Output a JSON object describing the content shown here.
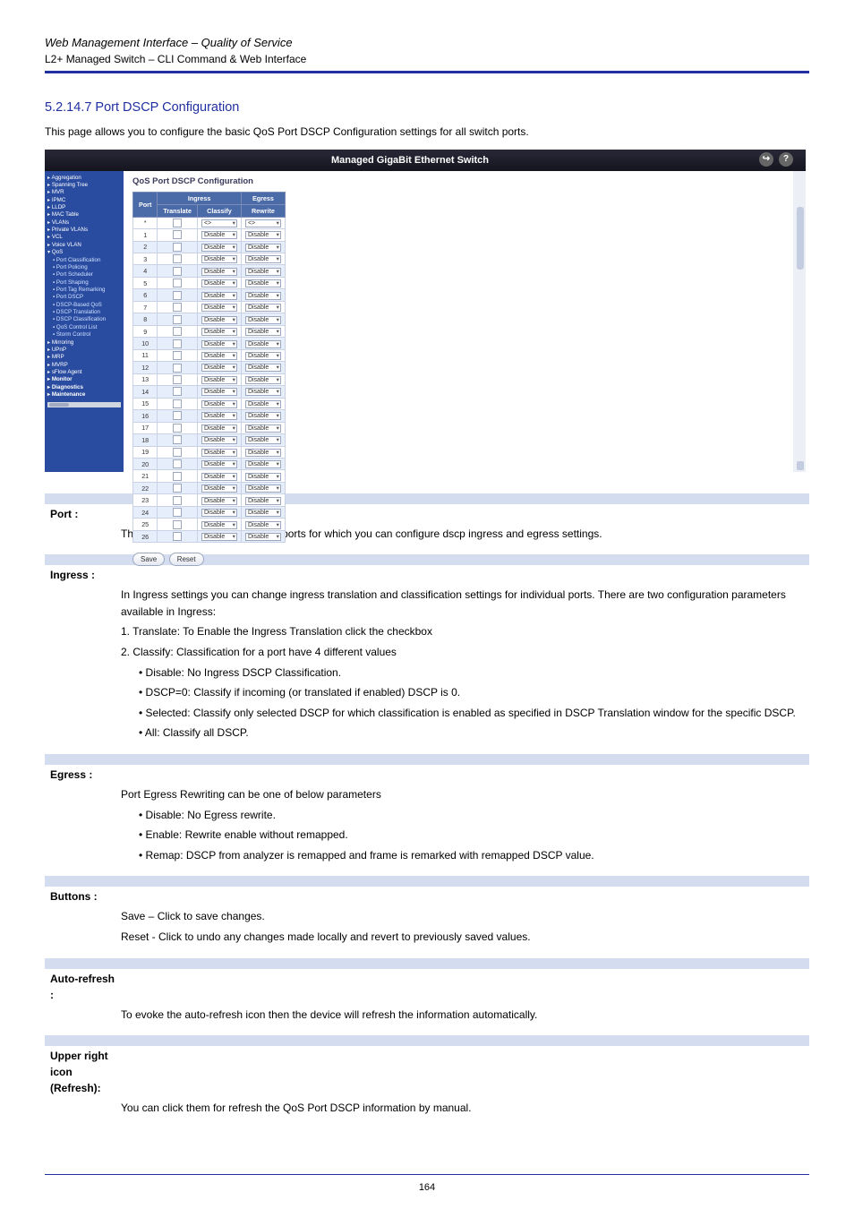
{
  "header": {
    "title_prefix": "Web Management Interface",
    "title_sep": "–",
    "title_rest": "Quality of Service",
    "sub_prefix": "L2+ Managed Switch",
    "sub_sep": "–",
    "sub_rest": "CLI Command & Web Interface"
  },
  "section": {
    "number": "5.2.14.7 Port DSCP Configuration",
    "intro": "This page allows you to configure the basic QoS Port DSCP Configuration settings for all switch ports."
  },
  "screenshot": {
    "banner": "Managed GigaBit Ethernet Switch",
    "icons": {
      "logout": "↪",
      "help": "?"
    },
    "nav": [
      {
        "label": "▸ Aggregation",
        "cls": "top"
      },
      {
        "label": "▸ Spanning Tree",
        "cls": "top"
      },
      {
        "label": "▸ MVR",
        "cls": "top"
      },
      {
        "label": "▸ IPMC",
        "cls": "top"
      },
      {
        "label": "▸ LLDP",
        "cls": "top"
      },
      {
        "label": "▸ MAC Table",
        "cls": "top"
      },
      {
        "label": "▸ VLANs",
        "cls": "top"
      },
      {
        "label": "▸ Private VLANs",
        "cls": "top"
      },
      {
        "label": "▸ VCL",
        "cls": "top"
      },
      {
        "label": "▸ Voice VLAN",
        "cls": "top"
      },
      {
        "label": "▾ QoS",
        "cls": "grp"
      },
      {
        "label": "▪ Port Classification",
        "cls": "sub"
      },
      {
        "label": "▪ Port Policing",
        "cls": "sub"
      },
      {
        "label": "▪ Port Scheduler",
        "cls": "sub"
      },
      {
        "label": "▪ Port Shaping",
        "cls": "sub"
      },
      {
        "label": "▪ Port Tag Remarking",
        "cls": "sub"
      },
      {
        "label": "▪ Port DSCP",
        "cls": "sub"
      },
      {
        "label": "▪ DSCP-Based QoS",
        "cls": "sub"
      },
      {
        "label": "▪ DSCP Translation",
        "cls": "sub"
      },
      {
        "label": "▪ DSCP Classification",
        "cls": "sub"
      },
      {
        "label": "▪ QoS Control List",
        "cls": "sub"
      },
      {
        "label": "▪ Storm Control",
        "cls": "sub"
      },
      {
        "label": "▸ Mirroring",
        "cls": "top"
      },
      {
        "label": "▸ UPnP",
        "cls": "top"
      },
      {
        "label": "▸ MRP",
        "cls": "top"
      },
      {
        "label": "▸ MVRP",
        "cls": "top"
      },
      {
        "label": "▸ sFlow Agent",
        "cls": "top"
      },
      {
        "label": "▸ Monitor",
        "cls": "hdr"
      },
      {
        "label": "▸ Diagnostics",
        "cls": "hdr"
      },
      {
        "label": "▸ Maintenance",
        "cls": "hdr"
      }
    ],
    "content_title": "QoS Port DSCP Configuration",
    "table": {
      "headers": {
        "port": "Port",
        "ingress": "Ingress",
        "translate": "Translate",
        "classify": "Classify",
        "egress": "Egress",
        "rewrite": "Rewrite"
      },
      "star_row": {
        "port": "*",
        "classify": "<>",
        "rewrite": "<>"
      },
      "cell_classify": "Disable",
      "cell_rewrite": "Disable",
      "ports": [
        "1",
        "2",
        "3",
        "4",
        "5",
        "6",
        "7",
        "8",
        "9",
        "10",
        "11",
        "12",
        "13",
        "14",
        "15",
        "16",
        "17",
        "18",
        "19",
        "20",
        "21",
        "22",
        "23",
        "24",
        "25",
        "26"
      ]
    },
    "buttons": {
      "save": "Save",
      "reset": "Reset"
    }
  },
  "objects": [
    {
      "label": "Port :",
      "desc": "The Port column shows the list of ports for which you can configure dscp ingress and egress settings."
    },
    {
      "label": "Ingress :",
      "desc": "In Ingress settings you can change ingress translation and classification settings for individual ports. There are two configuration parameters available in Ingress:",
      "desc2": "1. Translate: To Enable the Ingress Translation click the checkbox",
      "desc3": "2. Classify: Classification for a port have 4 different values",
      "bullets": [
        "Disable: No Ingress DSCP Classification.",
        "DSCP=0: Classify if incoming (or translated if enabled) DSCP is 0.",
        "Selected: Classify only selected DSCP for which classification is enabled as specified in DSCP Translation window for the specific DSCP.",
        "All: Classify all DSCP."
      ]
    },
    {
      "label": "Egress :",
      "desc": "Port Egress Rewriting can be one of below parameters",
      "bullets": [
        "Disable: No Egress rewrite.",
        "Enable: Rewrite enable without remapped.",
        "Remap: DSCP from analyzer is remapped and frame is remarked with remapped DSCP value."
      ]
    },
    {
      "label": "Buttons :",
      "desc": "Save – Click to save changes.",
      "desc2": "Reset - Click to undo any changes made locally and revert to previously saved values."
    },
    {
      "label": "Auto-refresh :",
      "desc": "To evoke the auto-refresh icon then the device will refresh the information automatically."
    },
    {
      "label": "Upper right icon (Refresh):",
      "desc": "You can click them for refresh the QoS Port DSCP information by manual."
    }
  ],
  "footer": {
    "page": "164"
  }
}
